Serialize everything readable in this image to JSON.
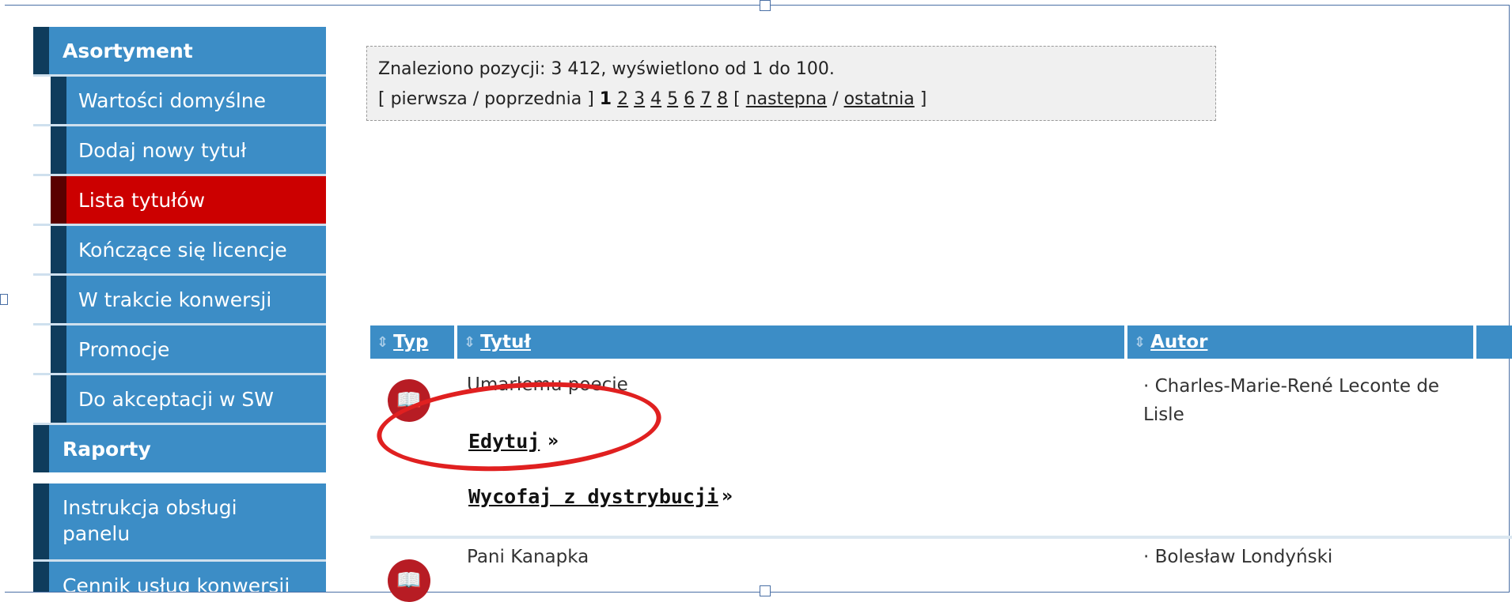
{
  "sidebar": {
    "section_assortment": "Asortyment",
    "items": [
      {
        "label": "Wartości domyślne"
      },
      {
        "label": "Dodaj nowy tytuł"
      },
      {
        "label": "Lista tytułów"
      },
      {
        "label": "Kończące się licencje"
      },
      {
        "label": "W trakcie konwersji"
      },
      {
        "label": "Promocje"
      },
      {
        "label": "Do akceptacji w SW"
      }
    ],
    "section_reports": "Raporty",
    "info_items": [
      {
        "label_line1": "Instrukcja obsługi",
        "label_line2": "panelu"
      },
      {
        "label": "Cennik usług konwersji"
      }
    ]
  },
  "results": {
    "summary": "Znaleziono pozycji: 3 412, wyświetlono od 1 do 100.",
    "open_bracket": "[",
    "first": "pierwsza",
    "slash": "/",
    "previous": "poprzednia",
    "close_bracket": "]",
    "current_page": "1",
    "pages": [
      "2",
      "3",
      "4",
      "5",
      "6",
      "7",
      "8"
    ],
    "next": "nastepna",
    "last": "ostatnia"
  },
  "table": {
    "columns": {
      "type": "Typ",
      "title": "Tytuł",
      "author": "Autor"
    },
    "rows": [
      {
        "title": "Umarłemu poecie",
        "author_line1": "· Charles-Marie-René Leconte de",
        "author_line2": "Lisle",
        "edit": "Edytuj",
        "withdraw": "Wycofaj z dystrybucji",
        "arrow": "»"
      },
      {
        "title": "Pani Kanapka",
        "author_line1": "· Bolesław Londyński"
      }
    ]
  },
  "colors": {
    "accent": "#3c8dc6",
    "active": "#cc0000",
    "highlight_circle": "#e02020"
  },
  "icons": {
    "book": "book-icon",
    "sort": "sort-icon"
  }
}
